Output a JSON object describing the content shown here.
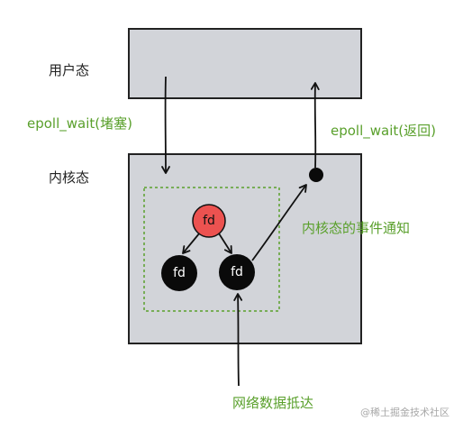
{
  "labels": {
    "user_space": "用户态",
    "kernel_space": "内核态",
    "epoll_wait_block": "epoll_wait(堵塞)",
    "epoll_wait_return": "epoll_wait(返回)",
    "kernel_event_notify": "内核态的事件通知",
    "network_data_arrive": "网络数据抵达"
  },
  "nodes": {
    "root": "fd",
    "left_child": "fd",
    "right_child": "fd"
  },
  "watermark": "@稀土掘金技术社区",
  "colors": {
    "box_fill": "#d2d4d9",
    "box_stroke": "#222222",
    "accent_green": "#5aa02c",
    "root_node": "#ec5250",
    "child_node": "#0a0a0a"
  }
}
